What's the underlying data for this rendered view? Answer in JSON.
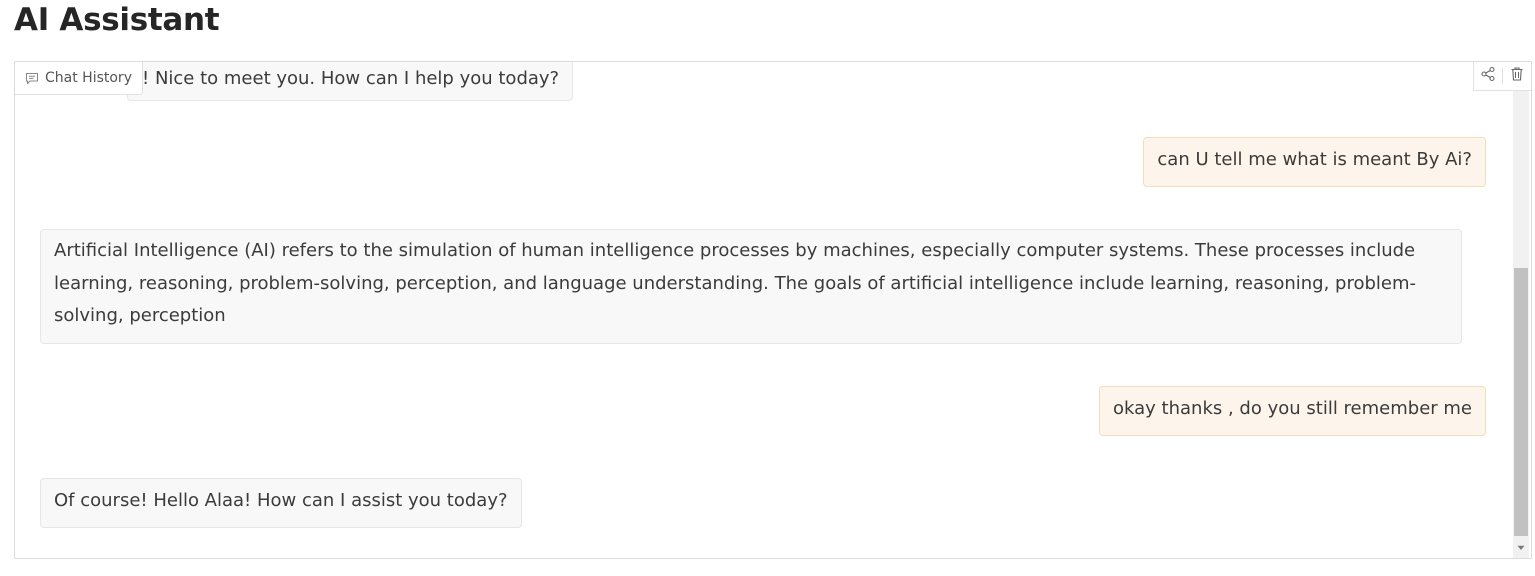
{
  "page": {
    "title": "AI Assistant"
  },
  "toolbar": {
    "history_label": "Chat History",
    "history_icon": "chat-history-icon",
    "share_icon": "share-icon",
    "delete_icon": "trash-icon"
  },
  "messages": [
    {
      "role": "assistant",
      "text": "! Nice to meet you. How can I help you today?"
    },
    {
      "role": "user",
      "text": "can U tell me what is meant By Ai?"
    },
    {
      "role": "assistant",
      "text": "Artificial Intelligence (AI) refers to the simulation of human intelligence processes by machines, especially computer systems. These processes include learning, reasoning, problem-solving, perception, and language understanding. The goals of artificial intelligence include learning, reasoning, problem-solving, perception"
    },
    {
      "role": "user",
      "text": "okay thanks , do you still remember me"
    },
    {
      "role": "assistant",
      "text": "Of course! Hello Alaa! How can I assist you today?"
    }
  ],
  "colors": {
    "assistant_bubble_bg": "#f8f8f8",
    "user_bubble_bg": "#fdf5eb",
    "user_bubble_border": "#f6dcb9"
  }
}
